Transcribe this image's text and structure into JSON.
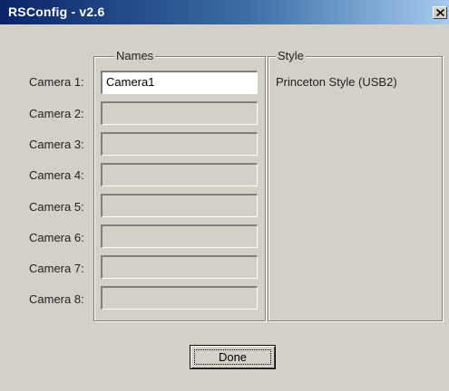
{
  "window": {
    "title": "RSConfig - v2.6",
    "close_glyph": "×"
  },
  "names_group": {
    "label": "Names",
    "cameras": [
      {
        "label": "Camera 1:",
        "value": "Camera1"
      },
      {
        "label": "Camera 2:",
        "value": ""
      },
      {
        "label": "Camera 3:",
        "value": ""
      },
      {
        "label": "Camera 4:",
        "value": ""
      },
      {
        "label": "Camera 5:",
        "value": ""
      },
      {
        "label": "Camera 6:",
        "value": ""
      },
      {
        "label": "Camera 7:",
        "value": ""
      },
      {
        "label": "Camera 8:",
        "value": ""
      }
    ]
  },
  "style_group": {
    "label": "Style",
    "value": "Princeton Style (USB2)"
  },
  "done_button": {
    "label": "Done"
  },
  "colors": {
    "title_start": "#0a246a",
    "title_end": "#a6caf0",
    "face": "#d4d0c8"
  }
}
